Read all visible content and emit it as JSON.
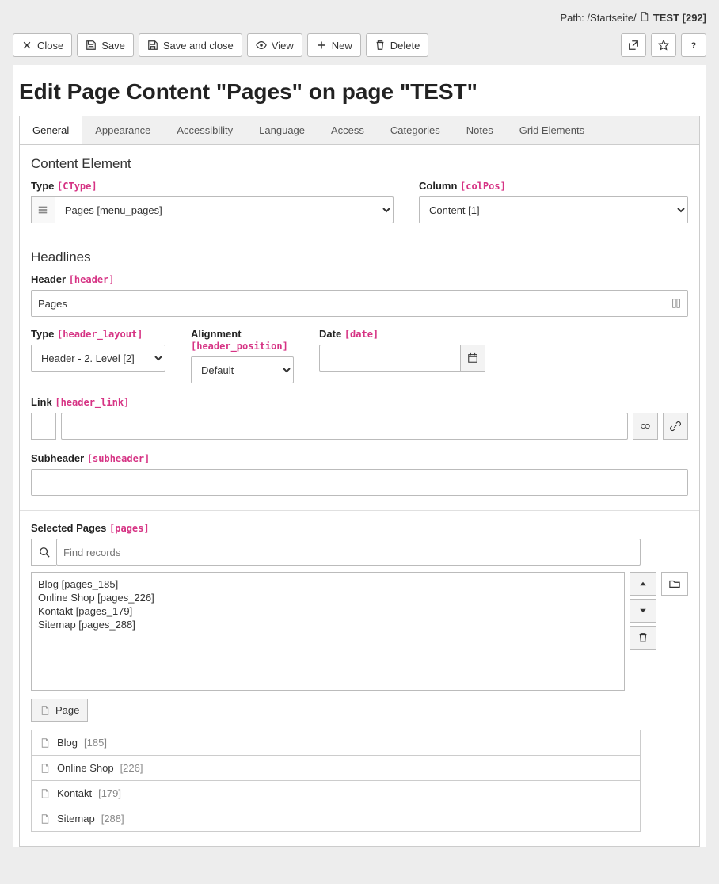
{
  "path": {
    "label": "Path:",
    "segments": "/Startseite/",
    "page": "TEST [292]"
  },
  "toolbar": {
    "close": "Close",
    "save": "Save",
    "saveClose": "Save and close",
    "view": "View",
    "new": "New",
    "delete": "Delete"
  },
  "title": "Edit Page Content \"Pages\" on page \"TEST\"",
  "tabs": [
    "General",
    "Appearance",
    "Accessibility",
    "Language",
    "Access",
    "Categories",
    "Notes",
    "Grid Elements"
  ],
  "section_content": {
    "title": "Content Element",
    "type_label": "Type",
    "type_ref": "[CType]",
    "type_value": "Pages [menu_pages]",
    "col_label": "Column",
    "col_ref": "[colPos]",
    "col_value": "Content [1]"
  },
  "section_headlines": {
    "title": "Headlines",
    "header_label": "Header",
    "header_ref": "[header]",
    "header_value": "Pages",
    "type_label": "Type",
    "type_ref": "[header_layout]",
    "type_value": "Header - 2. Level [2]",
    "align_label": "Alignment",
    "align_ref": "[header_position]",
    "align_value": "Default",
    "date_label": "Date",
    "date_ref": "[date]",
    "date_value": "",
    "link_label": "Link",
    "link_ref": "[header_link]",
    "link_value": "",
    "sub_label": "Subheader",
    "sub_ref": "[subheader]",
    "sub_value": ""
  },
  "section_pages": {
    "label": "Selected Pages",
    "ref": "[pages]",
    "search_placeholder": "Find records",
    "items": [
      {
        "text": "Blog [pages_185]"
      },
      {
        "text": "Online Shop [pages_226]"
      },
      {
        "text": "Kontakt [pages_179]"
      },
      {
        "text": "Sitemap [pages_288]"
      }
    ],
    "page_btn": "Page",
    "records": [
      {
        "name": "Blog",
        "id": "[185]"
      },
      {
        "name": "Online Shop",
        "id": "[226]"
      },
      {
        "name": "Kontakt",
        "id": "[179]"
      },
      {
        "name": "Sitemap",
        "id": "[288]"
      }
    ]
  }
}
